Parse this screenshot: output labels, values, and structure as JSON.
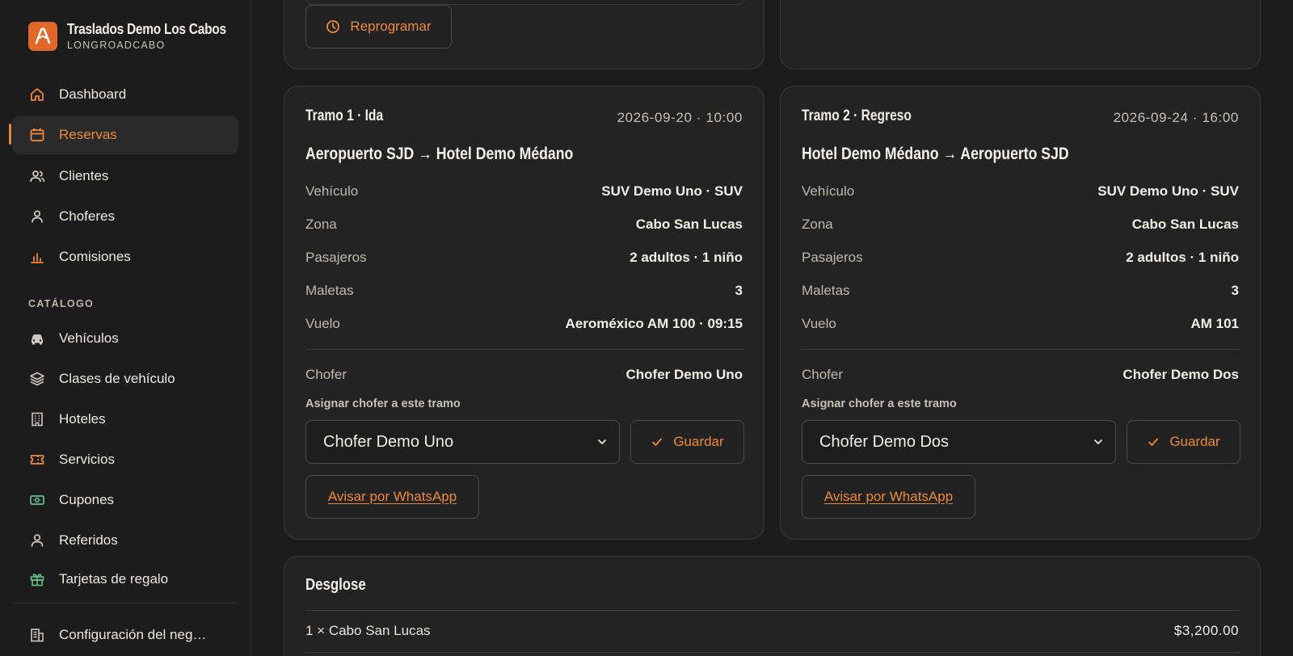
{
  "brand": {
    "name": "Traslados Demo Los Cabos",
    "subtitle": "LONGROADCABO"
  },
  "sidebar": {
    "items": [
      {
        "label": "Dashboard",
        "icon": "home-icon"
      },
      {
        "label": "Reservas",
        "icon": "calendar-icon",
        "active": true
      },
      {
        "label": "Clientes",
        "icon": "users-icon"
      },
      {
        "label": "Choferes",
        "icon": "driver-icon"
      },
      {
        "label": "Comisiones",
        "icon": "bar-chart-icon"
      }
    ],
    "catalog_label": "CATÁLOGO",
    "catalog_items": [
      {
        "label": "Vehículos",
        "icon": "car-icon"
      },
      {
        "label": "Clases de vehículo",
        "icon": "layers-icon"
      },
      {
        "label": "Hoteles",
        "icon": "building-icon"
      },
      {
        "label": "Servicios",
        "icon": "ticket-icon"
      },
      {
        "label": "Cupones",
        "icon": "banknote-icon"
      },
      {
        "label": "Referidos",
        "icon": "user-icon"
      },
      {
        "label": "Tarjetas de regalo",
        "icon": "gift-icon"
      }
    ],
    "settings_label": "Configuración del neg…"
  },
  "top": {
    "reschedule_label": "Reprogramar"
  },
  "legs": [
    {
      "title": "Tramo 1 · Ida",
      "datetime": "2026-09-20 · 10:00",
      "route": "Aeropuerto SJD → Hotel Demo Médano",
      "rows": [
        {
          "label": "Vehículo",
          "value": "SUV Demo Uno · SUV"
        },
        {
          "label": "Zona",
          "value": "Cabo San Lucas"
        },
        {
          "label": "Pasajeros",
          "value": "2 adultos · 1 niño"
        },
        {
          "label": "Maletas",
          "value": "3"
        },
        {
          "label": "Vuelo",
          "value": "Aeroméxico AM 100 · 09:15"
        }
      ],
      "driver_label": "Chofer",
      "driver_value": "Chofer Demo Uno",
      "assign_label": "Asignar chofer a este tramo",
      "selected_driver": "Chofer Demo Uno",
      "save_label": "Guardar",
      "whatsapp_label": "Avisar por WhatsApp"
    },
    {
      "title": "Tramo 2 · Regreso",
      "datetime": "2026-09-24 · 16:00",
      "route": "Hotel Demo Médano → Aeropuerto SJD",
      "rows": [
        {
          "label": "Vehículo",
          "value": "SUV Demo Uno · SUV"
        },
        {
          "label": "Zona",
          "value": "Cabo San Lucas"
        },
        {
          "label": "Pasajeros",
          "value": "2 adultos · 1 niño"
        },
        {
          "label": "Maletas",
          "value": "3"
        },
        {
          "label": "Vuelo",
          "value": "AM 101"
        }
      ],
      "driver_label": "Chofer",
      "driver_value": "Chofer Demo Dos",
      "assign_label": "Asignar chofer a este tramo",
      "selected_driver": "Chofer Demo Dos",
      "save_label": "Guardar",
      "whatsapp_label": "Avisar por WhatsApp"
    }
  ],
  "desglose": {
    "title": "Desglose",
    "lines": [
      {
        "label": "1 × Cabo San Lucas",
        "amount": "$3,200.00"
      }
    ]
  },
  "colors": {
    "accent": "#ee8a3c",
    "background": "#1c1c1c",
    "card": "#232323",
    "green_icon": "#5fc38a"
  }
}
